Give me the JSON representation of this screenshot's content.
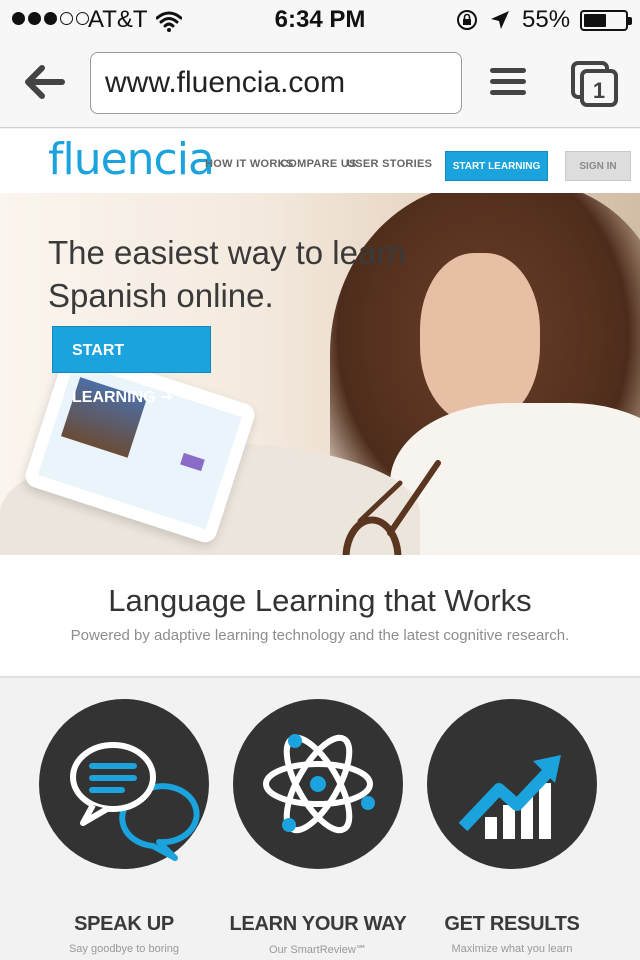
{
  "status_bar": {
    "carrier": "AT&T",
    "time": "6:34 PM",
    "battery": "55%",
    "battery_level": 0.55,
    "signal_bars": 3,
    "signal_total": 5
  },
  "browser": {
    "url": "www.fluencia.com",
    "tab_count": "1"
  },
  "site": {
    "logo": "fluencia",
    "nav": [
      "HOW IT WORKS",
      "COMPARE US",
      "USER STORIES"
    ],
    "cta_header": "START LEARNING",
    "sign_in": "SIGN IN",
    "brand_color": "#1aa3dd"
  },
  "hero": {
    "title_line1": "The easiest way to learn",
    "title_line2": "Spanish online.",
    "button": "START LEARNING ➜"
  },
  "tagline": {
    "title": "Language Learning that Works",
    "subtitle": "Powered by adaptive learning technology and the latest cognitive research."
  },
  "features": [
    {
      "title": "SPEAK UP",
      "subtitle": "Say goodbye to boring",
      "icon": "speech-bubbles-icon"
    },
    {
      "title": "LEARN YOUR WAY",
      "subtitle": "Our SmartReview℠",
      "icon": "atom-icon"
    },
    {
      "title": "GET RESULTS",
      "subtitle": "Maximize what you learn",
      "icon": "growth-chart-icon"
    }
  ]
}
